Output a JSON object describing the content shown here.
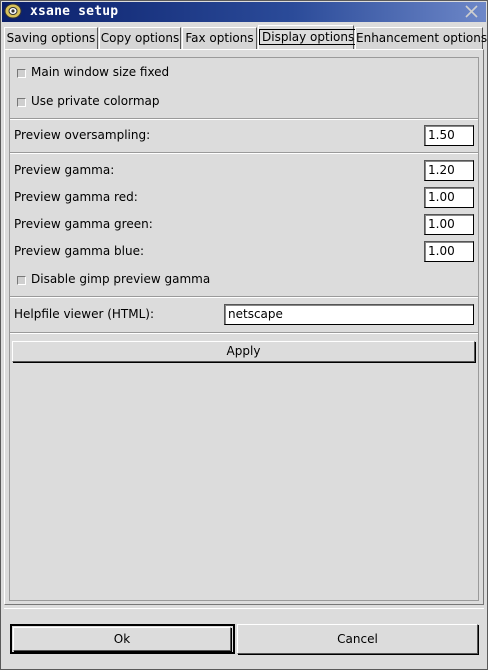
{
  "window": {
    "title": "xsane setup"
  },
  "tabs": [
    {
      "label": "Saving options"
    },
    {
      "label": "Copy options"
    },
    {
      "label": "Fax options"
    },
    {
      "label": "Display options"
    },
    {
      "label": "Enhancement options"
    }
  ],
  "display": {
    "main_window_fixed_label": "Main window size fixed",
    "private_colormap_label": "Use private colormap",
    "preview_oversampling_label": "Preview oversampling:",
    "preview_oversampling_value": "1.50",
    "preview_gamma_label": "Preview gamma:",
    "preview_gamma_value": "1.20",
    "preview_gamma_red_label": "Preview gamma red:",
    "preview_gamma_red_value": "1.00",
    "preview_gamma_green_label": "Preview gamma green:",
    "preview_gamma_green_value": "1.00",
    "preview_gamma_blue_label": "Preview gamma blue:",
    "preview_gamma_blue_value": "1.00",
    "disable_gimp_gamma_label": "Disable gimp preview gamma",
    "helpfile_viewer_label": "Helpfile viewer (HTML):",
    "helpfile_viewer_value": "netscape",
    "apply_label": "Apply"
  },
  "footer": {
    "ok_label": "Ok",
    "cancel_label": "Cancel"
  }
}
